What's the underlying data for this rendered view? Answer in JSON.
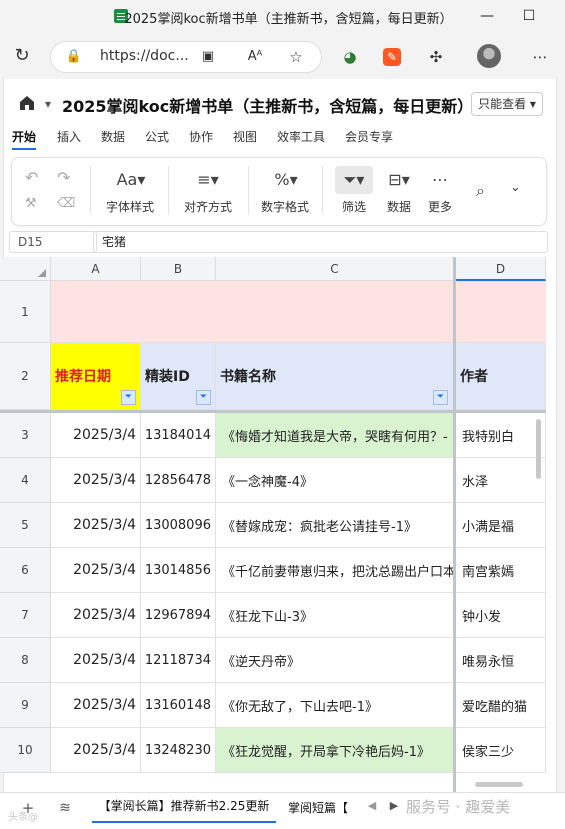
{
  "window": {
    "title": "2025掌阅koc新增书单（主推新书，含短篇，每日更新）"
  },
  "browser": {
    "url": "https://doc..."
  },
  "doc": {
    "title": "2025掌阅koc新增书单（主推新书，含短篇，每日更新）",
    "view_mode": "只能查看 ▾"
  },
  "menu": [
    "开始",
    "插入",
    "数据",
    "公式",
    "协作",
    "视图",
    "效率工具",
    "会员专享"
  ],
  "ribbon": {
    "font_style": "字体样式",
    "align": "对齐方式",
    "number_format": "数字格式",
    "filter": "筛选",
    "data": "数据",
    "more": "更多"
  },
  "formula_bar": {
    "cell_ref": "D15",
    "value": "宅猪"
  },
  "grid": {
    "columns": [
      "A",
      "B",
      "C",
      "D"
    ],
    "row_numbers": [
      "1",
      "2",
      "3",
      "4",
      "5",
      "6",
      "7",
      "8",
      "9",
      "10"
    ],
    "headers": {
      "date": "推荐日期",
      "id": "精装ID",
      "book": "书籍名称",
      "author": "作者"
    },
    "rows": [
      {
        "date": "2025/3/4",
        "id": "13184014",
        "book": "《悔婚才知道我是大帝，哭瞎有何用？-",
        "author": "我特别白",
        "highlight": true
      },
      {
        "date": "2025/3/4",
        "id": "12856478",
        "book": "《一念神魔-4》",
        "author": "水泽",
        "highlight": false
      },
      {
        "date": "2025/3/4",
        "id": "13008096",
        "book": "《替嫁成宠：疯批老公请挂号-1》",
        "author": "小满是福",
        "highlight": false
      },
      {
        "date": "2025/3/4",
        "id": "13014856",
        "book": "《千亿前妻带崽归来，把沈总踢出户口本",
        "author": "南宫紫嫣",
        "highlight": false
      },
      {
        "date": "2025/3/4",
        "id": "12967894",
        "book": "《狂龙下山-3》",
        "author": "钟小发",
        "highlight": false
      },
      {
        "date": "2025/3/4",
        "id": "12118734",
        "book": "《逆天丹帝》",
        "author": "唯易永恒",
        "highlight": false
      },
      {
        "date": "2025/3/4",
        "id": "13160148",
        "book": "《你无敌了，下山去吧-1》",
        "author": "爱吃醋的猫",
        "highlight": false
      },
      {
        "date": "2025/3/4",
        "id": "13248230",
        "book": "《狂龙觉醒，开局拿下冷艳后妈-1》",
        "author": "侯家三少",
        "highlight": true
      }
    ]
  },
  "sheet_tabs": {
    "active": "【掌阅长篇】推荐新书2.25更新",
    "second": "掌阅短篇【"
  },
  "watermark": {
    "text": "服务号 · 趣爱美",
    "corner": "头条@"
  },
  "colors": {
    "accent": "#1a73e8",
    "header_yellow": "#ffff00",
    "header_blue": "#dfe7f8",
    "row1_pink": "#fde4e2",
    "green_fill": "#d9f2d0",
    "header_red": "#e02020"
  }
}
